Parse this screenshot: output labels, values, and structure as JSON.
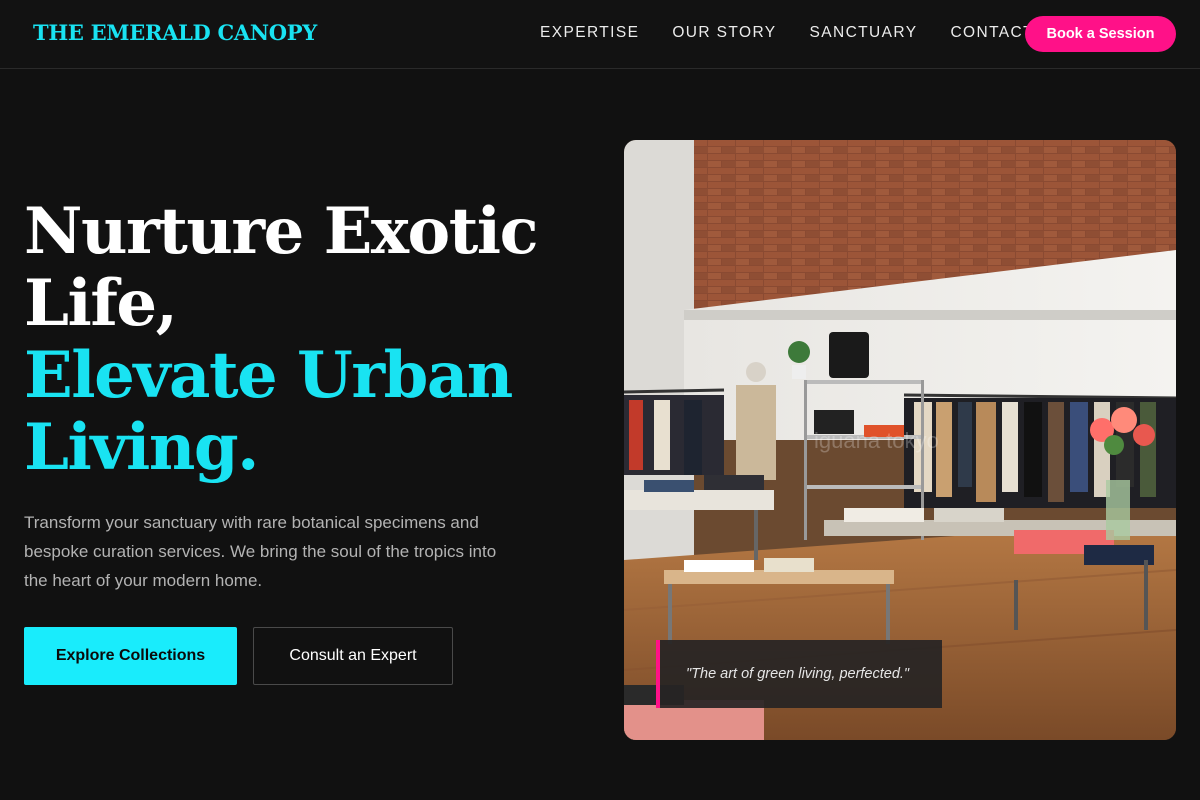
{
  "brand": "THE EMERALD CANOPY",
  "nav": {
    "links": [
      "EXPERTISE",
      "OUR STORY",
      "SANCTUARY",
      "CONTACT"
    ],
    "cta": "Book a Session"
  },
  "hero": {
    "headline_line1": "Nurture Exotic",
    "headline_line2": "Life,",
    "headline_line3": "Elevate Urban",
    "headline_line4": "Living.",
    "description": "Transform your sanctuary with rare botanical specimens and bespoke curation services. We bring the soul of the tropics into the heart of your modern home.",
    "primary_button": "Explore Collections",
    "secondary_button": "Consult an Expert"
  },
  "image": {
    "quote": "\"The art of green living, perfected.\"",
    "watermark": "iguana tokyo"
  },
  "colors": {
    "accent_cyan": "#19e3f2",
    "accent_pink": "#ff1188",
    "background": "#111111"
  }
}
